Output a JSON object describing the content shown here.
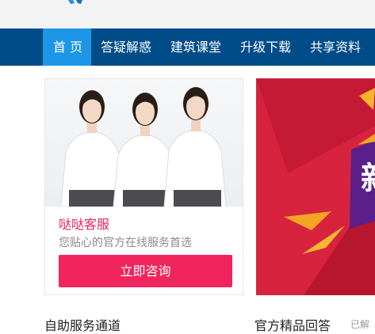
{
  "nav": {
    "items": [
      {
        "label": "首 页",
        "active": true
      },
      {
        "label": "答疑解惑",
        "active": false
      },
      {
        "label": "建筑课堂",
        "active": false
      },
      {
        "label": "升级下载",
        "active": false
      },
      {
        "label": "共享资料",
        "active": false
      }
    ]
  },
  "service_card": {
    "title": "哒哒客服",
    "subtitle": "您贴心的官方在线服务首选",
    "button_label": "立即咨询"
  },
  "banner": {
    "partial_text": "新"
  },
  "sections": {
    "left_heading": "自助服务通道",
    "right_heading": "官方精品回答",
    "right_sub": "已解"
  },
  "colors": {
    "nav_bg": "#004c88",
    "nav_active": "#1d96e8",
    "accent_pink": "#f0255d",
    "banner_red": "#d8233f"
  }
}
